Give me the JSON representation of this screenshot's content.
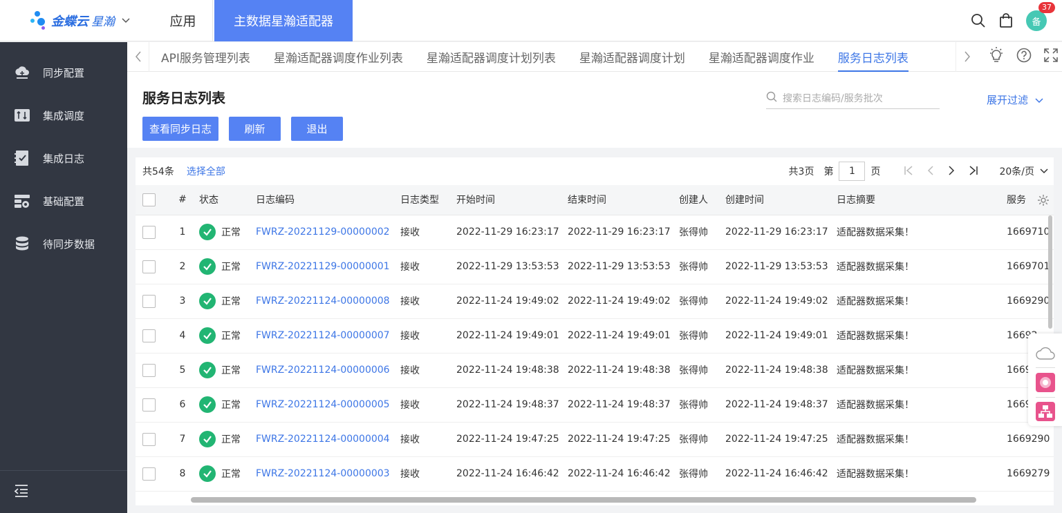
{
  "topbar": {
    "logo_brand": "金蝶云",
    "logo_product": "星瀚",
    "app_label": "应用",
    "active_app": "主数据星瀚适配器",
    "avatar_text": "备",
    "notification_count": "37"
  },
  "sidebar": {
    "items": [
      {
        "label": "同步配置",
        "icon": "cloud-sync-icon"
      },
      {
        "label": "集成调度",
        "icon": "schedule-icon"
      },
      {
        "label": "集成日志",
        "icon": "log-check-icon"
      },
      {
        "label": "基础配置",
        "icon": "config-icon"
      },
      {
        "label": "待同步数据",
        "icon": "database-icon"
      }
    ]
  },
  "tabs": {
    "items": [
      {
        "label": "API服务管理列表",
        "active": false
      },
      {
        "label": "星瀚适配器调度作业列表",
        "active": false
      },
      {
        "label": "星瀚适配器调度计划列表",
        "active": false
      },
      {
        "label": "星瀚适配器调度计划",
        "active": false
      },
      {
        "label": "星瀚适配器调度作业",
        "active": false
      },
      {
        "label": "服务日志列表",
        "active": true
      }
    ]
  },
  "page": {
    "title": "服务日志列表",
    "buttons": {
      "view_sync_log": "查看同步日志",
      "refresh": "刷新",
      "exit": "退出"
    },
    "search_placeholder": "搜索日志编码/服务批次",
    "expand_filter": "展开过滤"
  },
  "list": {
    "total": "共54条",
    "select_all": "选择全部",
    "total_pages": "共3页",
    "page_prefix": "第",
    "page_current": "1",
    "page_suffix": "页",
    "page_size": "20条/页",
    "columns": [
      "#",
      "状态",
      "日志编码",
      "日志类型",
      "开始时间",
      "结束时间",
      "创建人",
      "创建时间",
      "日志摘要",
      "服务"
    ],
    "rows": [
      {
        "no": "1",
        "status": "正常",
        "code": "FWRZ-20221129-00000002",
        "type": "接收",
        "start": "2022-11-29 16:23:17",
        "end": "2022-11-29 16:23:17",
        "creator": "张得帅",
        "created": "2022-11-29 16:23:17",
        "summary": "适配器数据采集！",
        "service": "1669710"
      },
      {
        "no": "2",
        "status": "正常",
        "code": "FWRZ-20221129-00000001",
        "type": "接收",
        "start": "2022-11-29 13:53:53",
        "end": "2022-11-29 13:53:53",
        "creator": "张得帅",
        "created": "2022-11-29 13:53:53",
        "summary": "适配器数据采集！",
        "service": "1669701"
      },
      {
        "no": "3",
        "status": "正常",
        "code": "FWRZ-20221124-00000008",
        "type": "接收",
        "start": "2022-11-24 19:49:02",
        "end": "2022-11-24 19:49:02",
        "creator": "张得帅",
        "created": "2022-11-24 19:49:02",
        "summary": "适配器数据采集！",
        "service": "1669290"
      },
      {
        "no": "4",
        "status": "正常",
        "code": "FWRZ-20221124-00000007",
        "type": "接收",
        "start": "2022-11-24 19:49:01",
        "end": "2022-11-24 19:49:01",
        "creator": "张得帅",
        "created": "2022-11-24 19:49:01",
        "summary": "适配器数据采集！",
        "service": "16692"
      },
      {
        "no": "5",
        "status": "正常",
        "code": "FWRZ-20221124-00000006",
        "type": "接收",
        "start": "2022-11-24 19:48:38",
        "end": "2022-11-24 19:48:38",
        "creator": "张得帅",
        "created": "2022-11-24 19:48:38",
        "summary": "适配器数据采集！",
        "service": "1669"
      },
      {
        "no": "6",
        "status": "正常",
        "code": "FWRZ-20221124-00000005",
        "type": "接收",
        "start": "2022-11-24 19:48:37",
        "end": "2022-11-24 19:48:37",
        "creator": "张得帅",
        "created": "2022-11-24 19:48:37",
        "summary": "适配器数据采集！",
        "service": "1669"
      },
      {
        "no": "7",
        "status": "正常",
        "code": "FWRZ-20221124-00000004",
        "type": "接收",
        "start": "2022-11-24 19:47:25",
        "end": "2022-11-24 19:47:25",
        "creator": "张得帅",
        "created": "2022-11-24 19:47:25",
        "summary": "适配器数据采集！",
        "service": "1669290"
      },
      {
        "no": "8",
        "status": "正常",
        "code": "FWRZ-20221124-00000003",
        "type": "接收",
        "start": "2022-11-24 16:46:42",
        "end": "2022-11-24 16:46:42",
        "creator": "张得帅",
        "created": "2022-11-24 16:46:42",
        "summary": "适配器数据采集！",
        "service": "1669279"
      }
    ]
  },
  "colors": {
    "primary": "#5582f3",
    "link": "#3d76e6",
    "sidebar_bg": "#323742",
    "success": "#22b573",
    "badge": "#e8343a"
  }
}
